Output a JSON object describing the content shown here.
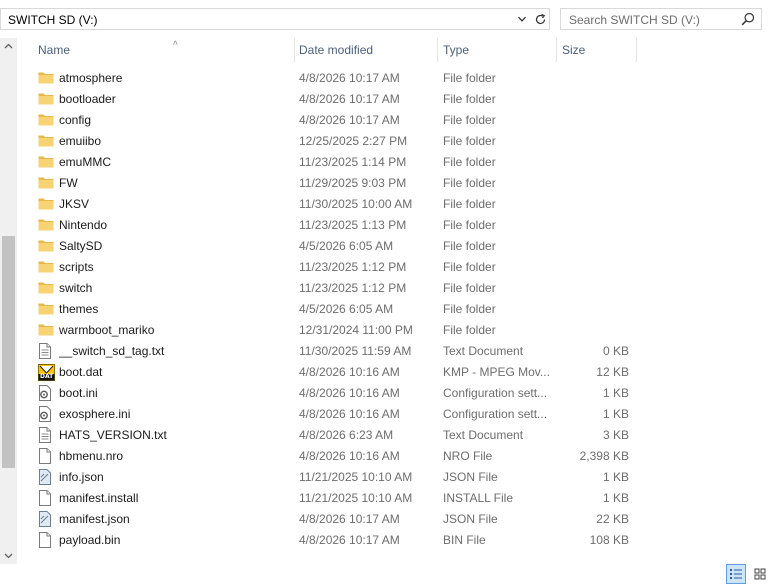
{
  "address": {
    "path": "SWITCH SD (V:)",
    "dropdown_icon": "chevron-down-icon",
    "refresh_icon": "refresh-icon"
  },
  "search": {
    "placeholder": "Search SWITCH SD (V:)",
    "icon": "search-icon"
  },
  "columns": {
    "name": "Name",
    "date": "Date modified",
    "type": "Type",
    "size": "Size"
  },
  "files": [
    {
      "name": "atmosphere",
      "date": "4/8/2026 10:17 AM",
      "type": "File folder",
      "size": "",
      "icon": "folder"
    },
    {
      "name": "bootloader",
      "date": "4/8/2026 10:17 AM",
      "type": "File folder",
      "size": "",
      "icon": "folder"
    },
    {
      "name": "config",
      "date": "4/8/2026 10:17 AM",
      "type": "File folder",
      "size": "",
      "icon": "folder"
    },
    {
      "name": "emuiibo",
      "date": "12/25/2025 2:27 PM",
      "type": "File folder",
      "size": "",
      "icon": "folder"
    },
    {
      "name": "emuMMC",
      "date": "11/23/2025 1:14 PM",
      "type": "File folder",
      "size": "",
      "icon": "folder"
    },
    {
      "name": "FW",
      "date": "11/29/2025 9:03 PM",
      "type": "File folder",
      "size": "",
      "icon": "folder"
    },
    {
      "name": "JKSV",
      "date": "11/30/2025 10:00 AM",
      "type": "File folder",
      "size": "",
      "icon": "folder"
    },
    {
      "name": "Nintendo",
      "date": "11/23/2025 1:13 PM",
      "type": "File folder",
      "size": "",
      "icon": "folder"
    },
    {
      "name": "SaltySD",
      "date": "4/5/2026 6:05 AM",
      "type": "File folder",
      "size": "",
      "icon": "folder"
    },
    {
      "name": "scripts",
      "date": "11/23/2025 1:12 PM",
      "type": "File folder",
      "size": "",
      "icon": "folder"
    },
    {
      "name": "switch",
      "date": "11/23/2025 1:12 PM",
      "type": "File folder",
      "size": "",
      "icon": "folder"
    },
    {
      "name": "themes",
      "date": "4/5/2026 6:05 AM",
      "type": "File folder",
      "size": "",
      "icon": "folder"
    },
    {
      "name": "warmboot_mariko",
      "date": "12/31/2024 11:00 PM",
      "type": "File folder",
      "size": "",
      "icon": "folder"
    },
    {
      "name": "__switch_sd_tag.txt",
      "date": "11/30/2025 11:59 AM",
      "type": "Text Document",
      "size": "0 KB",
      "icon": "text"
    },
    {
      "name": "boot.dat",
      "date": "4/8/2026 10:16 AM",
      "type": "KMP - MPEG Mov...",
      "size": "12 KB",
      "icon": "dat",
      "icon_label": "DAT"
    },
    {
      "name": "boot.ini",
      "date": "4/8/2026 10:16 AM",
      "type": "Configuration sett...",
      "size": "1 KB",
      "icon": "config"
    },
    {
      "name": "exosphere.ini",
      "date": "4/8/2026 10:16 AM",
      "type": "Configuration sett...",
      "size": "1 KB",
      "icon": "config"
    },
    {
      "name": "HATS_VERSION.txt",
      "date": "4/8/2026 6:23 AM",
      "type": "Text Document",
      "size": "3 KB",
      "icon": "text"
    },
    {
      "name": "hbmenu.nro",
      "date": "4/8/2026 10:16 AM",
      "type": "NRO File",
      "size": "2,398 KB",
      "icon": "blank"
    },
    {
      "name": "info.json",
      "date": "11/21/2025 10:10 AM",
      "type": "JSON File",
      "size": "1 KB",
      "icon": "json"
    },
    {
      "name": "manifest.install",
      "date": "11/21/2025 10:10 AM",
      "type": "INSTALL File",
      "size": "1 KB",
      "icon": "blank"
    },
    {
      "name": "manifest.json",
      "date": "4/8/2026 10:17 AM",
      "type": "JSON File",
      "size": "22 KB",
      "icon": "json"
    },
    {
      "name": "payload.bin",
      "date": "4/8/2026 10:17 AM",
      "type": "BIN File",
      "size": "108 KB",
      "icon": "blank"
    }
  ],
  "view_buttons": [
    {
      "icon": "details-view-icon",
      "active": true
    },
    {
      "icon": "large-icons-view-icon",
      "active": false
    }
  ]
}
